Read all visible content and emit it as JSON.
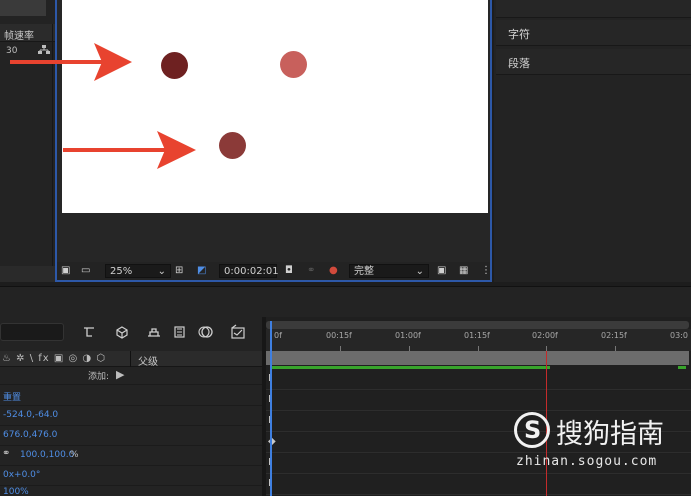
{
  "project_panel": {
    "column_header": "帧速率",
    "fps_value": "30"
  },
  "viewer": {
    "toolbar": {
      "zoom": "25%",
      "timecode": "0:00:02:01",
      "resolution": "完整"
    },
    "dots": [
      {
        "color": "#6e2121"
      },
      {
        "color": "#c8605c"
      },
      {
        "color": "#8b3a38"
      }
    ],
    "arrow_color": "#e8432f"
  },
  "right_panel": {
    "sections": [
      "字符",
      "段落"
    ]
  },
  "timeline": {
    "layer_header": {
      "symbols": "♨ ✲ \\ fx ▣ ◎ ◑ ⬡",
      "parent_label": "父级"
    },
    "add_label": "添加:",
    "properties": [
      {
        "label": "重置",
        "color": "#4f8ee6"
      },
      {
        "label": "-524.0,-64.0"
      },
      {
        "label": "676.0,476.0"
      },
      {
        "label": "100.0,100.0",
        "suffix": "%"
      },
      {
        "label": "0x+0.0°"
      },
      {
        "label": "100%"
      }
    ],
    "ruler_labels": [
      "0f",
      "00:15f",
      "01:00f",
      "01:15f",
      "02:00f",
      "02:15f",
      "03:0"
    ],
    "playhead_color": "#c42b2b"
  },
  "watermark": {
    "title": "搜狗指南",
    "url": "zhinan.sogou.com"
  }
}
